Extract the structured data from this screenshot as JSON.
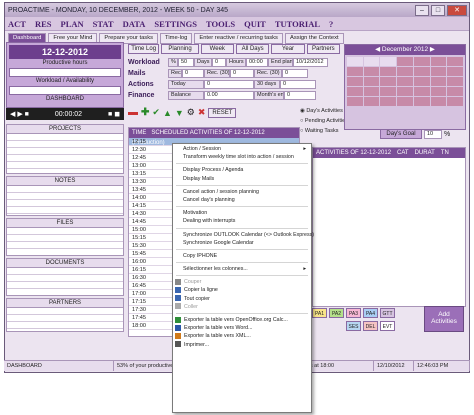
{
  "window": {
    "title": "PROACTIME - MONDAY, 10 DECEMBER, 2012 - WEEK 50 - DAY 345",
    "watermark": "SOFTPEDIA"
  },
  "menubar": [
    "ACT",
    "RES",
    "PLAN",
    "STAT",
    "DATA",
    "SETTINGS",
    "TOOLS",
    "QUIT",
    "TUTORIAL",
    "?"
  ],
  "tabs": [
    "Dashboard",
    "Free your Mind",
    "Prepare your tasks",
    "Time-log",
    "Enter reactive / recurring tasks",
    "Assign the Context"
  ],
  "left": {
    "date": "12-12-2012",
    "productive_label": "Productive hours",
    "workload_label": "Workload / Availability",
    "dashboard_label": "DASHBOARD",
    "time_left": "00:00:02",
    "projects": "PROJECTS",
    "notes": "NOTES",
    "files": "FILES",
    "documents": "DOCUMENTS",
    "partners": "PARTNERS"
  },
  "topbtns": [
    "Time Log",
    "Planning",
    "Week",
    "All Days",
    "Year",
    "Partners"
  ],
  "stats": {
    "workload": {
      "label": "Workload",
      "c1": "%",
      "v1": "50",
      "c2": "Days",
      "v2": "0",
      "c3": "Hours",
      "v3": "00:00",
      "c4": "End plan.",
      "v4": "10/12/2012"
    },
    "mails": {
      "label": "Mails",
      "c1": "Rec.",
      "v1": "0",
      "c2": "Rec. (30)",
      "v2": "0",
      "c3": "Rec. (30)",
      "v3": "0"
    },
    "actions": {
      "label": "Actions",
      "c1": "Today",
      "v1": "0",
      "c2": "30 days",
      "v2": "0"
    },
    "finance": {
      "label": "Finance",
      "c1": "Balance",
      "v1": "0.00",
      "c2": "Month's end",
      "v2": "0"
    }
  },
  "radios": [
    "Day's Activities",
    "Pending Activities",
    "Waiting Tasks"
  ],
  "calendar": {
    "title": "December 2012"
  },
  "daysgoal": {
    "label": "Day's Goal",
    "value": "10",
    "unit": "%"
  },
  "toolbar": {
    "reset": "RESET"
  },
  "table": {
    "time_col": "TIME",
    "header": "SCHEDULED ACTIVITIES OF 12-12-2012 (Production)",
    "times": [
      "12:15",
      "12:30",
      "12:45",
      "13:00",
      "13:15",
      "13:30",
      "13:45",
      "14:00",
      "14:15",
      "14:30",
      "14:45",
      "15:00",
      "15:15",
      "15:30",
      "15:45",
      "16:00",
      "16:15",
      "16:30",
      "16:45",
      "17:00",
      "17:15",
      "17:30",
      "17:45",
      "18:00"
    ],
    "right_header": "ACTIVITIES OF 12-12-2012",
    "right_cols": [
      "CAT",
      "DURAT",
      "TN"
    ]
  },
  "colorbtns": [
    "PA1",
    "PA2",
    "PA3",
    "PA4",
    "GTT",
    "SES",
    "DEL",
    "EVT"
  ],
  "add_activities": "Add Activities",
  "menu": {
    "items": [
      {
        "label": "Action / Session",
        "arrow": "▸",
        "gray": false
      },
      {
        "label": "Transform weekly time slot into action / session",
        "gray": false
      },
      {
        "sep": true
      },
      {
        "label": "Display Process / Agenda",
        "gray": false
      },
      {
        "label": "Display Mails",
        "gray": false
      },
      {
        "sep": true
      },
      {
        "label": "Cancel action / session planning",
        "gray": false
      },
      {
        "label": "Cancel day's planning",
        "gray": false
      },
      {
        "sep": true
      },
      {
        "label": "Motivation",
        "gray": false
      },
      {
        "label": "Dealing with interrupts",
        "gray": false
      },
      {
        "sep": true
      },
      {
        "label": "Synchronize OUTLOOK Calendar (<> Outlook Express)",
        "gray": false
      },
      {
        "label": "Synchronize Google Calendar",
        "gray": false
      },
      {
        "sep": true
      },
      {
        "label": "Copy IPHONE",
        "gray": false
      },
      {
        "sep": true
      },
      {
        "label": "Sélectionner les colonnes...",
        "arrow": "▸",
        "gray": false
      },
      {
        "sep": true
      },
      {
        "label": "Couper",
        "gray": true,
        "icon": "scissors-icon"
      },
      {
        "label": "Copier la ligne",
        "gray": false,
        "icon": "copy-icon"
      },
      {
        "label": "Tout copier",
        "gray": false,
        "icon": "copy-all-icon"
      },
      {
        "label": "Coller",
        "gray": true,
        "icon": "paste-icon"
      },
      {
        "sep": true
      },
      {
        "label": "Exporter la table vers OpenOffice.org Calc...",
        "gray": false,
        "icon": "calc-icon"
      },
      {
        "label": "Exporter la table vers Word...",
        "gray": false,
        "icon": "word-icon"
      },
      {
        "label": "Exporter la table vers XML...",
        "gray": false,
        "icon": "xml-icon"
      },
      {
        "label": "Imprimer...",
        "gray": false,
        "icon": "print-icon"
      }
    ]
  },
  "status": {
    "s1": "DASHBOARD",
    "s2": "53% of your productive",
    "s3": "and ends at 18:00",
    "s4": "12/10/2012",
    "s5": "12:46:03 PM"
  }
}
